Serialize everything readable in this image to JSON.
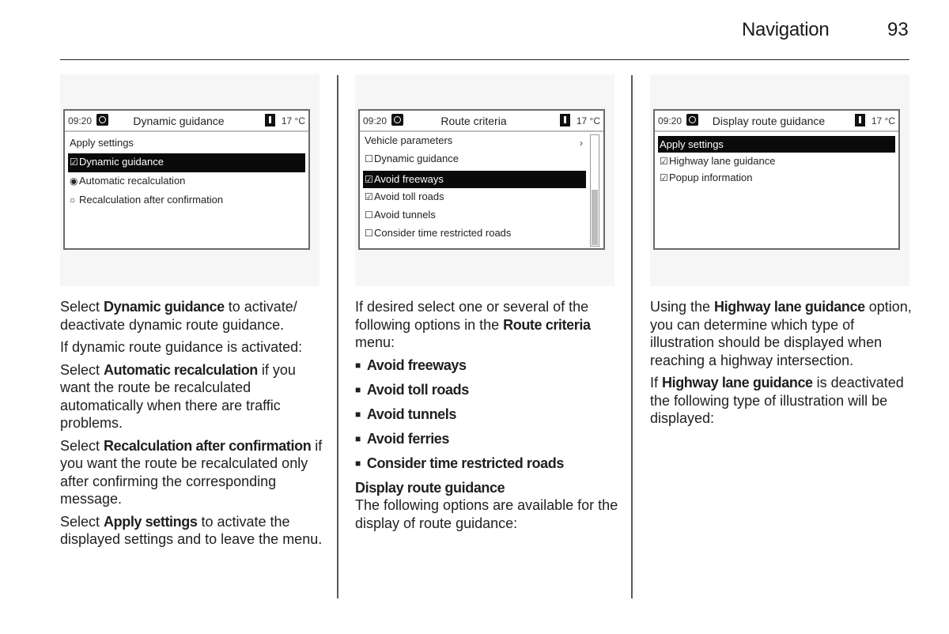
{
  "header": {
    "section": "Navigation",
    "page_number": "93"
  },
  "screens": [
    {
      "time": "09:20",
      "clock_icon": "clock-icon",
      "title": "Dynamic guidance",
      "thermometer_icon": "thermometer-icon",
      "temperature": "17 °C",
      "items": [
        {
          "mark": "",
          "label": "Apply settings",
          "selected": false
        },
        {
          "mark": "☑",
          "label": "Dynamic guidance",
          "selected": true
        },
        {
          "mark": "◉",
          "label": "Automatic recalculation",
          "selected": false
        },
        {
          "mark": "○",
          "label": "Recalculation after confirmation",
          "selected": false
        }
      ]
    },
    {
      "time": "09:20",
      "clock_icon": "clock-icon",
      "title": "Route criteria",
      "thermometer_icon": "thermometer-icon",
      "temperature": "17 °C",
      "submenu_arrow": "›",
      "scroll_position": 0.5,
      "items": [
        {
          "mark": "",
          "label": "Vehicle parameters",
          "selected": false
        },
        {
          "mark": "☐",
          "label": "Dynamic guidance",
          "selected": false
        },
        {
          "mark": "☑",
          "label": "Avoid freeways",
          "selected": true
        },
        {
          "mark": "☑",
          "label": "Avoid toll roads",
          "selected": false
        },
        {
          "mark": "☐",
          "label": "Avoid tunnels",
          "selected": false
        },
        {
          "mark": "☐",
          "label": "Consider time restricted roads",
          "selected": false
        }
      ]
    },
    {
      "time": "09:20",
      "clock_icon": "clock-icon",
      "title": "Display route guidance",
      "thermometer_icon": "thermometer-icon",
      "temperature": "17 °C",
      "items": [
        {
          "mark": "",
          "label": "Apply settings",
          "selected": true
        },
        {
          "mark": "☑",
          "label": "Highway lane guidance",
          "selected": false
        },
        {
          "mark": "☑",
          "label": "Popup information",
          "selected": false
        }
      ]
    }
  ],
  "col1": {
    "p1": {
      "a": "Select ",
      "b": "Dynamic guidance",
      "c": " to activate/ deactivate dynamic route guidance."
    },
    "p2": "If dynamic route guidance is activated:",
    "p3": {
      "a": "Select ",
      "b": "Automatic recalculation",
      "c": " if you want the route be recalculated automatically when there are traffic problems."
    },
    "p4": {
      "a": "Select ",
      "b": "Recalculation after confirmation",
      "c": " if you want the route be recalculated only after confirming the corresponding message."
    },
    "p5": {
      "a": "Select ",
      "b": "Apply settings",
      "c": " to activate the displayed settings and to leave the menu."
    }
  },
  "col2": {
    "p1": {
      "a": "If desired select one or several of the following options in the ",
      "b": "Route criteria",
      "c": " menu:"
    },
    "bullets": [
      "Avoid freeways",
      "Avoid toll roads",
      "Avoid tunnels",
      "Avoid ferries",
      "Consider time restricted roads"
    ],
    "subheading": "Display route guidance",
    "p2": "The following options are available for the display of route guidance:"
  },
  "col3": {
    "p1": {
      "a": "Using the ",
      "b": "Highway lane guidance",
      "c": " option, you can determine which type of illustration should be displayed when reaching a highway intersection."
    },
    "p2": {
      "a": "If ",
      "b": "Highway lane guidance",
      "c": " is deactivated the following type of illustration will be displayed:"
    }
  }
}
